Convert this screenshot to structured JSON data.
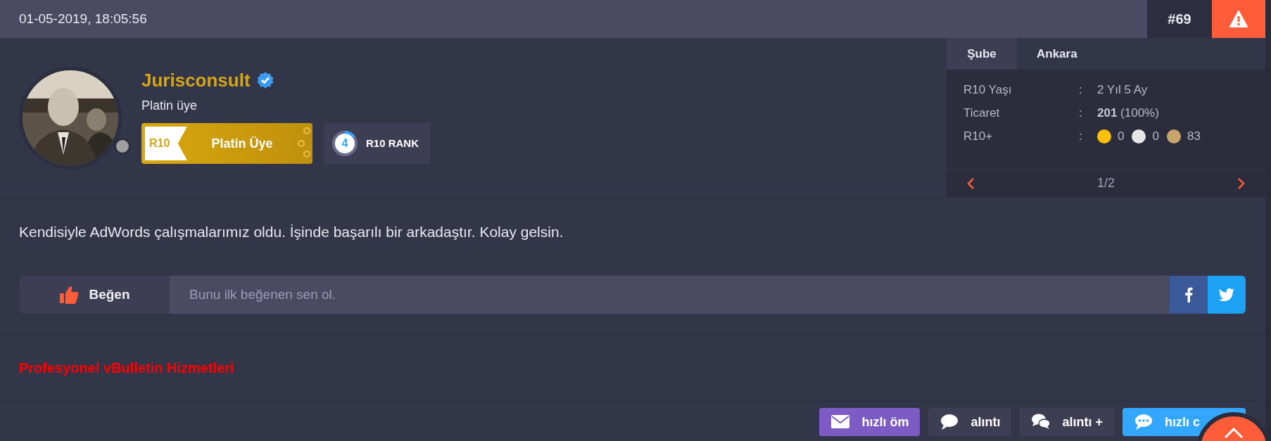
{
  "header": {
    "date": "01-05-2019, 18:05:56",
    "post_number": "#69"
  },
  "user": {
    "name": "Jurisconsult",
    "verified": true,
    "online": false,
    "title": "Platin üye",
    "badge": {
      "tag": "R10",
      "label": "Platin Üye"
    },
    "rank": {
      "value": "4",
      "label": "R10 RANK",
      "level": 0.15
    }
  },
  "info_panel": {
    "branch": {
      "label": "Şube",
      "value": "Ankara"
    },
    "rows": [
      {
        "kind": "text",
        "label": "R10 Yaşı",
        "separator": ":",
        "value": "2 Yıl 5 Ay"
      },
      {
        "kind": "text",
        "label": "Ticaret",
        "separator": ":",
        "value": "**201** (100%)"
      },
      {
        "kind": "medals",
        "label": "R10+",
        "separator": ":",
        "medals": [
          {
            "color": "#ffc107",
            "count": "0"
          },
          {
            "color": "#e6e6e6",
            "count": "0"
          },
          {
            "color": "#c8a56a",
            "count": "83"
          }
        ]
      }
    ],
    "pager": "1/2"
  },
  "post_text": "Kendisiyle AdWords çalışmalarımız oldu. İşinde başarılı bir arkadaştır. Kolay gelsin.",
  "like_bar": {
    "button": "Beğen",
    "text": "Bunu ilk beğenen sen ol."
  },
  "signature": "Profesyonel vBulletin Hizmetleri",
  "actions": [
    {
      "kind": "envelope",
      "label": "hızlı öm",
      "color": "#7c5cc4"
    },
    {
      "kind": "comment",
      "label": "alıntı",
      "color": "#3d3e53"
    },
    {
      "kind": "comments",
      "label": "alıntı +",
      "color": "#3d3e53"
    },
    {
      "kind": "comment-dots",
      "label": "hızlı c",
      "color": "#33a7ff"
    }
  ]
}
